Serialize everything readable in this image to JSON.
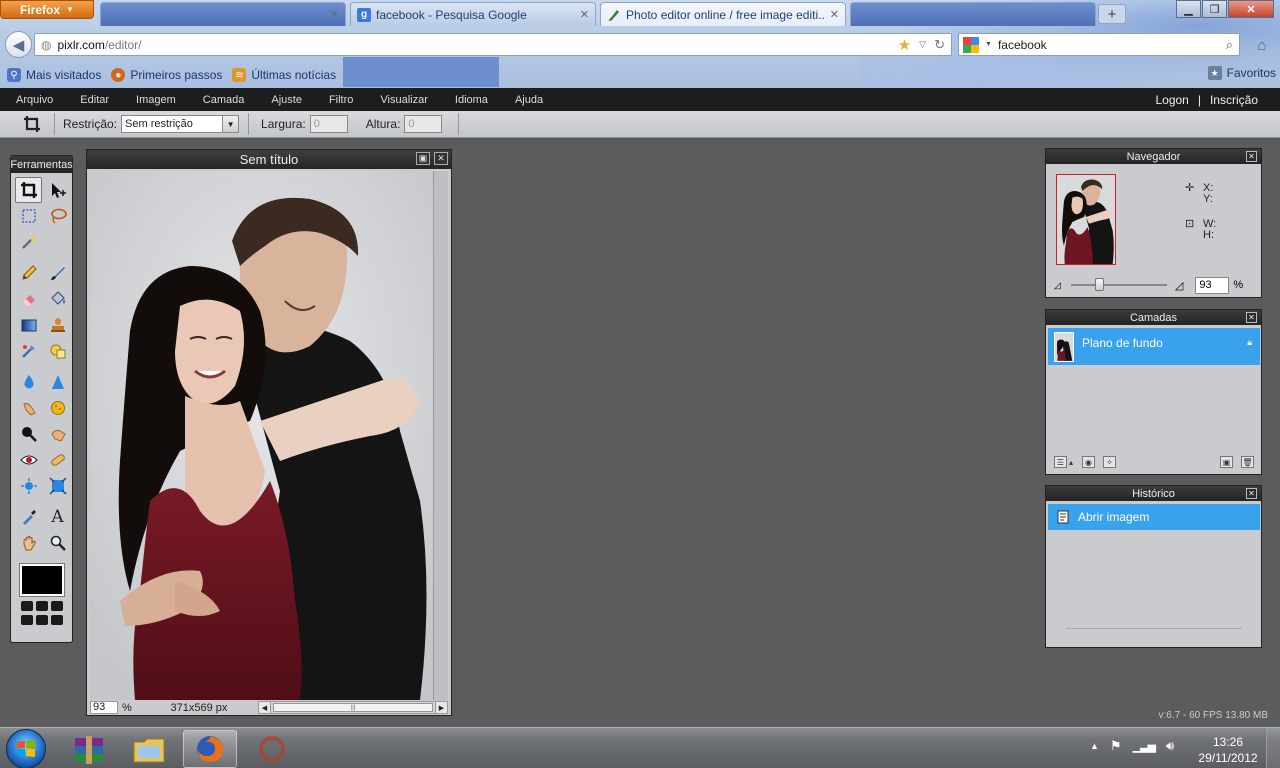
{
  "browser": {
    "menu_button": "Firefox",
    "tabs": [
      {
        "label": "",
        "state": "blank"
      },
      {
        "label": "facebook - Pesquisa Google",
        "favicon": "google-icon"
      },
      {
        "label": "Photo editor online / free image editi...",
        "favicon": "brush-icon",
        "active": true
      },
      {
        "label": "",
        "state": "blank"
      }
    ],
    "url": {
      "host": "pixlr.com",
      "path": "/editor/"
    },
    "search_query": "facebook",
    "bookmarks": [
      "Mais visitados",
      "Primeiros passos",
      "Últimas notícias"
    ],
    "favorites_label": "Favoritos"
  },
  "app": {
    "menu": [
      "Arquivo",
      "Editar",
      "Imagem",
      "Camada",
      "Ajuste",
      "Filtro",
      "Visualizar",
      "Idioma",
      "Ajuda"
    ],
    "account": {
      "login": "Logon",
      "separator": "|",
      "signup": "Inscrição"
    },
    "options": {
      "restriction_label": "Restrição:",
      "restriction_value": "Sem restrição",
      "width_label": "Largura:",
      "width_value": "0",
      "height_label": "Altura:",
      "height_value": "0"
    },
    "tools_title": "Ferramentas",
    "document": {
      "title": "Sem título",
      "zoom": "93",
      "zoom_unit": "%",
      "dimensions": "371x569 px"
    },
    "navigator": {
      "title": "Navegador",
      "x_label": "X:",
      "y_label": "Y:",
      "w_label": "W:",
      "h_label": "H:",
      "zoom": "93",
      "zoom_unit": "%",
      "zoom_slider_fraction": 0.28
    },
    "layers": {
      "title": "Camadas",
      "items": [
        {
          "name": "Plano de fundo",
          "locked": true
        }
      ]
    },
    "history": {
      "title": "Histórico",
      "items": [
        {
          "name": "Abrir imagem"
        }
      ]
    },
    "version": "v:6.7 - 60 FPS 13.80 MB"
  },
  "taskbar": {
    "clock_time": "13:26",
    "clock_date": "29/11/2012",
    "apps": [
      "winrar-icon",
      "explorer-folder-icon",
      "firefox-icon",
      "app-icon"
    ]
  },
  "colors": {
    "accent_selection": "#39a2ec",
    "app_dark": "#1d1d1d",
    "workspace": "#5c5c5c",
    "dress": "#6d1521"
  }
}
